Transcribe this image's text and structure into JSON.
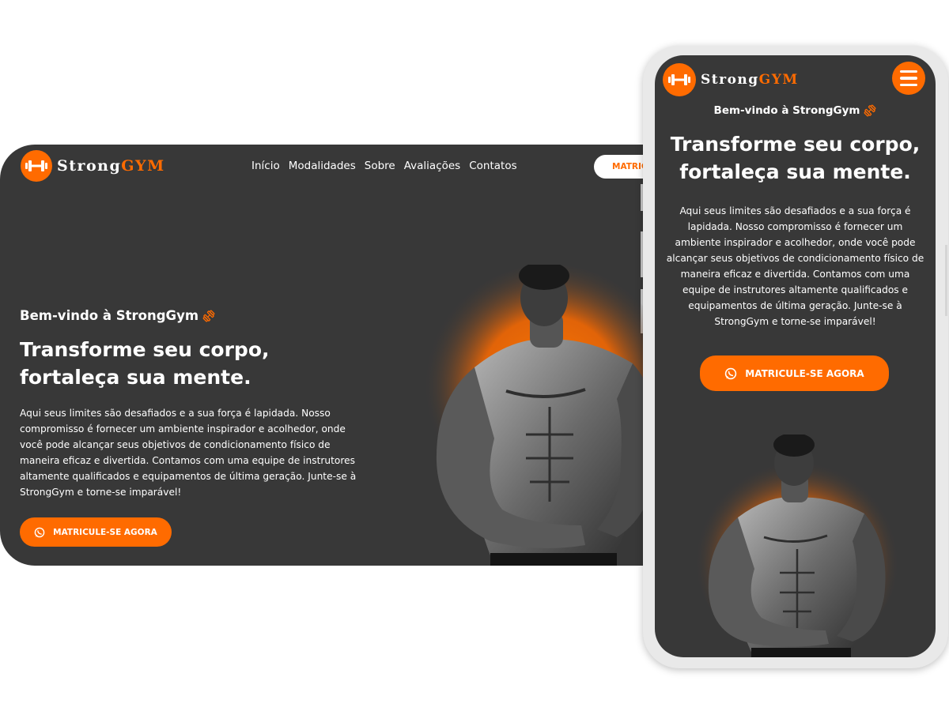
{
  "brand": {
    "strong": "Strong",
    "gym": "GYM"
  },
  "nav": {
    "items": [
      "Início",
      "Modalidades",
      "Sobre",
      "Avaliações",
      "Contatos"
    ]
  },
  "header_cta": {
    "label": "MATRICULE-SE AGORA"
  },
  "hero": {
    "welcome": "Bem-vindo à StrongGym",
    "title": "Transforme seu corpo, fortaleça sua mente.",
    "text": "Aqui seus limites são desafiados e a sua força é lapidada. Nosso compromisso é fornecer um ambiente inspirador e acolhedor, onde você pode alcançar seus objetivos de condicionamento físico de maneira eficaz e divertida. Contamos com uma equipe de instrutores altamente qualificados e equipamentos de última geração. Junte-se à StrongGym e torne-se imparável!",
    "cta": "MATRICULE-SE AGORA"
  },
  "icons": {
    "logo": "dumbbell-icon",
    "welcome": "dumbbell-icon",
    "cta": "whatsapp-icon",
    "menu": "hamburger-menu-icon"
  },
  "colors": {
    "accent": "#ff6b00",
    "background": "#383838",
    "text": "#ffffff"
  }
}
